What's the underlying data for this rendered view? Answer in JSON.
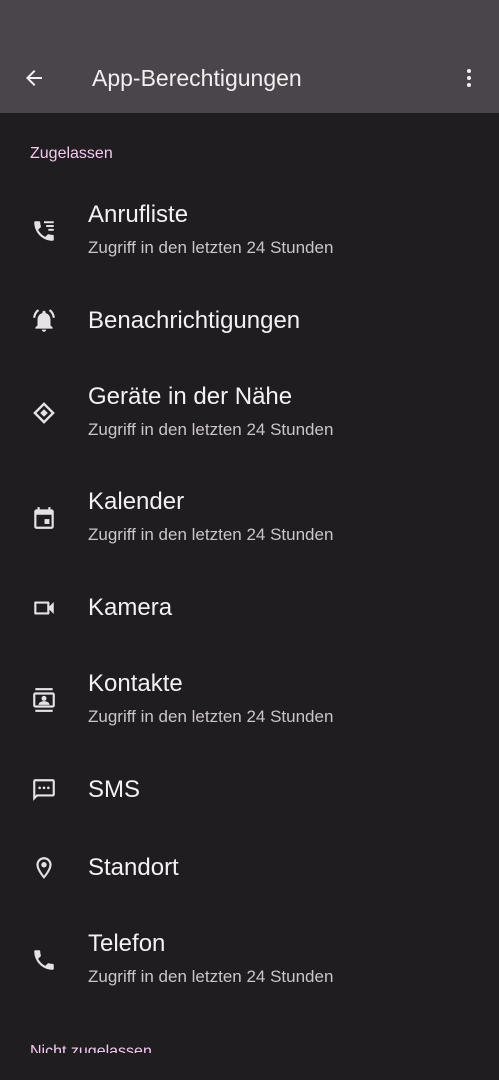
{
  "appbar": {
    "title": "App-Berechtigungen",
    "back_icon": "arrow-back-icon",
    "menu_icon": "more-vert-icon"
  },
  "colors": {
    "background": "#1f1d20",
    "appbar": "#49454a",
    "section_header": "#f5c8f0",
    "title_text": "#f4f0f4",
    "subtitle_text": "#cbc5cb"
  },
  "section": {
    "header": "Zugelassen",
    "next_header": "Nicht zugelassen"
  },
  "permissions": [
    {
      "title": "Anrufliste",
      "subtitle": "Zugriff in den letzten 24 Stunden",
      "icon": "call-log-icon"
    },
    {
      "title": "Benachrichtigungen",
      "subtitle": "",
      "icon": "notification-bell-icon"
    },
    {
      "title": "Geräte in der Nähe",
      "subtitle": "Zugriff in den letzten 24 Stunden",
      "icon": "nearby-devices-icon"
    },
    {
      "title": "Kalender",
      "subtitle": "Zugriff in den letzten 24 Stunden",
      "icon": "calendar-icon"
    },
    {
      "title": "Kamera",
      "subtitle": "",
      "icon": "camera-icon"
    },
    {
      "title": "Kontakte",
      "subtitle": "Zugriff in den letzten 24 Stunden",
      "icon": "contacts-icon"
    },
    {
      "title": "SMS",
      "subtitle": "",
      "icon": "sms-icon"
    },
    {
      "title": "Standort",
      "subtitle": "",
      "icon": "location-icon"
    },
    {
      "title": "Telefon",
      "subtitle": "Zugriff in den letzten 24 Stunden",
      "icon": "phone-icon"
    }
  ]
}
